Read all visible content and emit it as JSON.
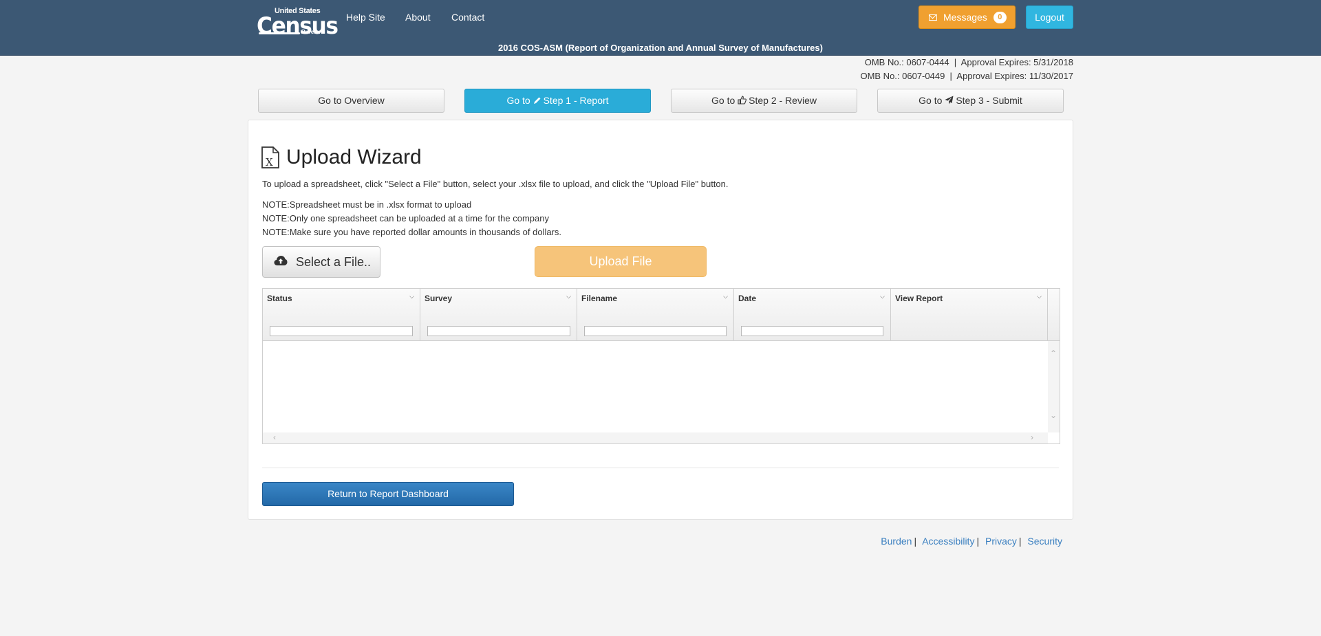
{
  "header": {
    "logo": {
      "line1": "United States",
      "line2": "Census",
      "line3": "Bureau"
    },
    "nav": [
      {
        "label": "Help Site"
      },
      {
        "label": "About"
      },
      {
        "label": "Contact"
      }
    ],
    "messages_label": "Messages",
    "messages_count": "0",
    "logout_label": "Logout",
    "survey_title": "2016 COS-ASM (Report of Organization and Annual Survey of Manufactures)"
  },
  "omb": [
    "OMB No.: 0607-0444  |  Approval Expires: 5/31/2018",
    "OMB No.: 0607-0449  |  Approval Expires: 11/30/2017"
  ],
  "steps": [
    {
      "prefix": "Go to",
      "label": "Overview",
      "icon": "none"
    },
    {
      "prefix": "Go to",
      "label": "Step 1 - Report",
      "icon": "pencil-icon"
    },
    {
      "prefix": "Go to",
      "label": "Step 2 - Review",
      "icon": "thumbs-up-icon"
    },
    {
      "prefix": "Go to",
      "label": "Step 3 - Submit",
      "icon": "paper-plane-icon"
    }
  ],
  "wizard": {
    "title": "Upload Wizard",
    "instructions": "To upload a spreadsheet, click \"Select a File\" button, select your .xlsx file to upload, and click the \"Upload File\" button.",
    "notes": [
      "NOTE:Spreadsheet must be in .xlsx format to upload",
      "NOTE:Only one spreadsheet can be uploaded at a time for the company",
      "NOTE:Make sure you have reported dollar amounts in thousands of dollars."
    ],
    "select_label": "Select a File..",
    "upload_label": "Upload File"
  },
  "grid": {
    "columns": [
      "Status",
      "Survey",
      "Filename",
      "Date",
      "View Report"
    ],
    "rows": []
  },
  "return_label": "Return to Report Dashboard",
  "footer": {
    "links": [
      "Burden",
      "Accessibility",
      "Privacy",
      "Security"
    ]
  },
  "colors": {
    "header_bg": "#3c5874",
    "messages_btn": "#f0a030",
    "logout_btn": "#30b6e0",
    "active_step": "#2aacd8",
    "upload_btn": "#f6c47a",
    "return_btn": "#2d78b8",
    "link": "#3a7fc0"
  }
}
